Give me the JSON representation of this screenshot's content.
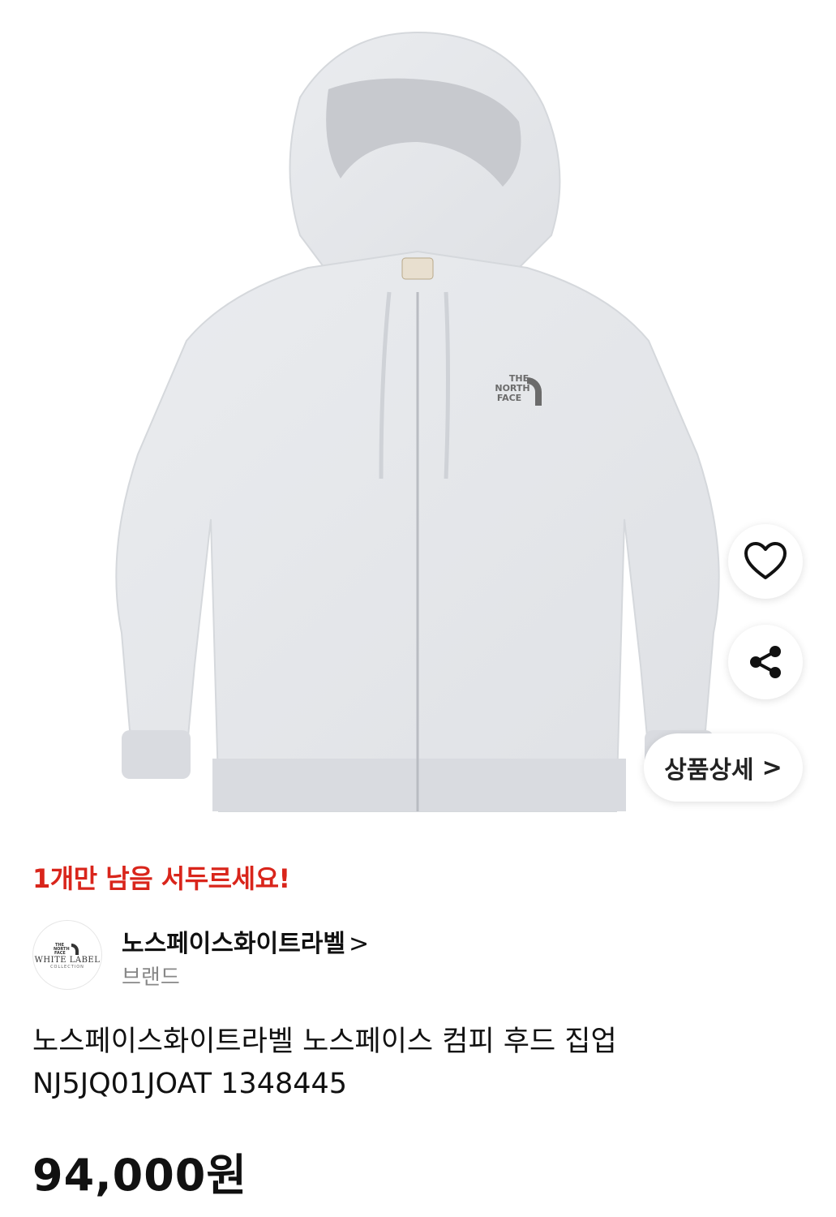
{
  "product": {
    "image_alt": "grey zip-up hoodie",
    "stock_alert": "1개만 남음 서두르세요!",
    "brand": {
      "name": "노스페이스화이트라벨",
      "arrow": ">",
      "type": "브랜드",
      "logo_text": "WHITE LABEL",
      "logo_sub": "COLLECTION",
      "logo_mark": "THE NORTH FACE"
    },
    "title_line1": "노스페이스화이트라벨 노스페이스 컴피 후드 집업",
    "title_line2": "NJ5JQ01JOAT 1348445",
    "price": "94,000원"
  },
  "actions": {
    "like_icon": "heart-icon",
    "share_icon": "share-icon",
    "detail_label": "상품상세",
    "detail_chevron": ">"
  },
  "colors": {
    "alert": "#d9251b",
    "hoodie": "#e4e6ea",
    "hoodie_shadow": "#c9ccd1"
  }
}
